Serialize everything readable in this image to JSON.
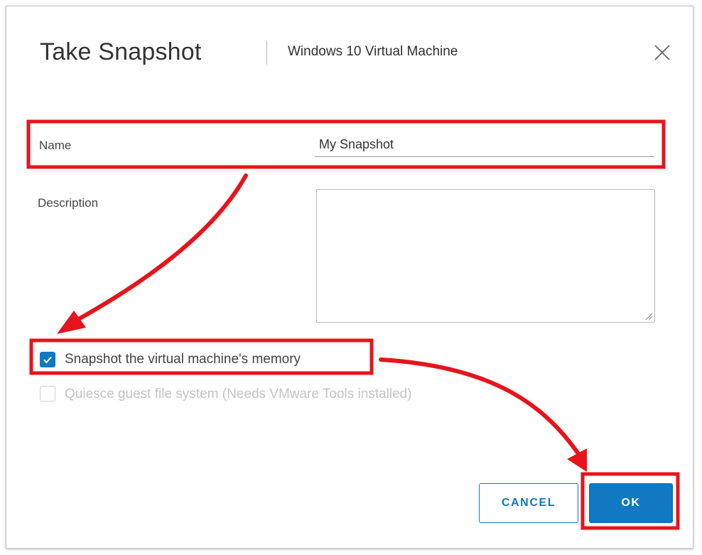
{
  "dialog": {
    "title": "Take Snapshot",
    "subtitle": "Windows 10 Virtual Machine",
    "close_icon": "close-icon"
  },
  "form": {
    "name_label": "Name",
    "name_value": "My Snapshot",
    "description_label": "Description",
    "description_value": "",
    "memory_label": "Snapshot the virtual machine's memory",
    "memory_checked": true,
    "quiesce_label": "Quiesce guest file system (Needs VMware Tools installed)",
    "quiesce_checked": false,
    "quiesce_enabled": false
  },
  "buttons": {
    "cancel_label": "CANCEL",
    "ok_label": "OK"
  },
  "colors": {
    "accent": "#0f79c2",
    "annotation": "#e8141b"
  }
}
